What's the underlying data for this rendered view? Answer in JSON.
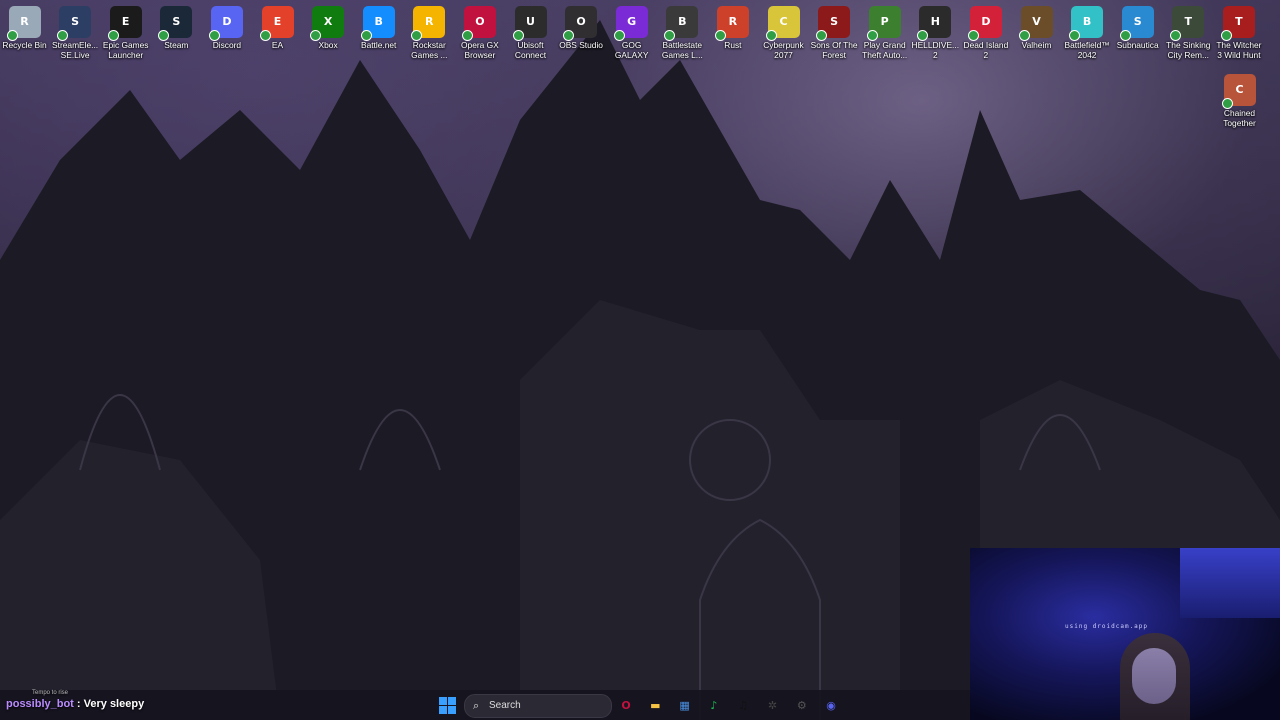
{
  "desktop_icons": [
    {
      "label": "Recycle Bin",
      "icon": "recycle-bin-icon",
      "color": "#9aa9b8"
    },
    {
      "label": "StreamEle... SE.Live",
      "icon": "streamelements-icon",
      "color": "#2c3e63"
    },
    {
      "label": "Epic Games Launcher",
      "icon": "epic-games-icon",
      "color": "#1b1b1b"
    },
    {
      "label": "Steam",
      "icon": "steam-icon",
      "color": "#1b2838"
    },
    {
      "label": "Discord",
      "icon": "discord-icon",
      "color": "#5865f2"
    },
    {
      "label": "EA",
      "icon": "ea-icon",
      "color": "#e4412a"
    },
    {
      "label": "Xbox",
      "icon": "xbox-icon",
      "color": "#107c10"
    },
    {
      "label": "Battle.net",
      "icon": "battlenet-icon",
      "color": "#148eff"
    },
    {
      "label": "Rockstar Games ...",
      "icon": "rockstar-icon",
      "color": "#f4b400"
    },
    {
      "label": "Opera GX Browser",
      "icon": "opera-gx-icon",
      "color": "#c1123f"
    },
    {
      "label": "Ubisoft Connect",
      "icon": "ubisoft-icon",
      "color": "#2c2c2c"
    },
    {
      "label": "OBS Studio",
      "icon": "obs-icon",
      "color": "#302e31"
    },
    {
      "label": "GOG GALAXY",
      "icon": "gog-galaxy-icon",
      "color": "#7b2bd6"
    },
    {
      "label": "Battlestate Games L...",
      "icon": "battlestate-icon",
      "color": "#3a3a3a"
    },
    {
      "label": "Rust",
      "icon": "rust-icon",
      "color": "#cd412b"
    },
    {
      "label": "Cyberpunk 2077",
      "icon": "cyberpunk-icon",
      "color": "#d8c53a"
    },
    {
      "label": "Sons Of The Forest",
      "icon": "sons-of-the-forest-icon",
      "color": "#8d1a1a"
    },
    {
      "label": "Play Grand Theft Auto...",
      "icon": "gta-v-icon",
      "color": "#3c7f2f"
    },
    {
      "label": "HELLDIVE... 2",
      "icon": "helldivers-icon",
      "color": "#2b2b2b"
    },
    {
      "label": "Dead Island 2",
      "icon": "dead-island-icon",
      "color": "#d4213a"
    },
    {
      "label": "Valheim",
      "icon": "valheim-icon",
      "color": "#6b4d2a"
    },
    {
      "label": "Battlefield™ 2042",
      "icon": "battlefield-icon",
      "color": "#33c1c8"
    },
    {
      "label": "Subnautica",
      "icon": "subnautica-icon",
      "color": "#2a8ad1"
    },
    {
      "label": "The Sinking City Rem...",
      "icon": "sinking-city-icon",
      "color": "#3c4a3a"
    },
    {
      "label": "The Witcher 3 Wild Hunt",
      "icon": "witcher-icon",
      "color": "#a81d1d"
    },
    {
      "label": "Chained Together",
      "icon": "chained-together-icon",
      "color": "#b8543a"
    }
  ],
  "chat": {
    "username": "possibly_bot",
    "separator": ":",
    "message": "Very sleepy",
    "overlay_small": "Tempo to rise"
  },
  "taskbar": {
    "search_placeholder": "Search",
    "pinned": [
      {
        "icon": "opera-gx-icon",
        "color": "#c1123f",
        "glyph": "O"
      },
      {
        "icon": "file-explorer-icon",
        "color": "#f5c343",
        "glyph": "▬"
      },
      {
        "icon": "microsoft-store-icon",
        "color": "#4a90e2",
        "glyph": "▦"
      },
      {
        "icon": "spotify-icon",
        "color": "#1db954",
        "glyph": "♪"
      },
      {
        "icon": "tiktok-icon",
        "color": "#111111",
        "glyph": "♫"
      },
      {
        "icon": "chatgpt-icon",
        "color": "#444444",
        "glyph": "✲"
      },
      {
        "icon": "settings-gear-icon",
        "color": "#555555",
        "glyph": "⚙"
      },
      {
        "icon": "discord-icon",
        "color": "#5865f2",
        "glyph": "◉"
      }
    ]
  },
  "webcam": {
    "overlay_text": "using droidcam.app"
  }
}
